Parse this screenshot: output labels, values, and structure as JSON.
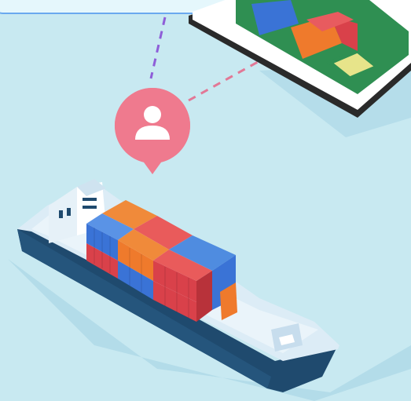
{
  "scene": {
    "description_icon": "person-icon",
    "colors": {
      "water": "#c8e9f1",
      "pin": "#ef7a8e",
      "hull_dark": "#1f4a6e",
      "deck": "#dcecf6",
      "container_red": "#d9414a",
      "container_orange": "#ef7a2c",
      "container_blue": "#3a73d6",
      "dashed_purple": "#8e5ed8",
      "dashed_pink": "#e27896"
    }
  }
}
